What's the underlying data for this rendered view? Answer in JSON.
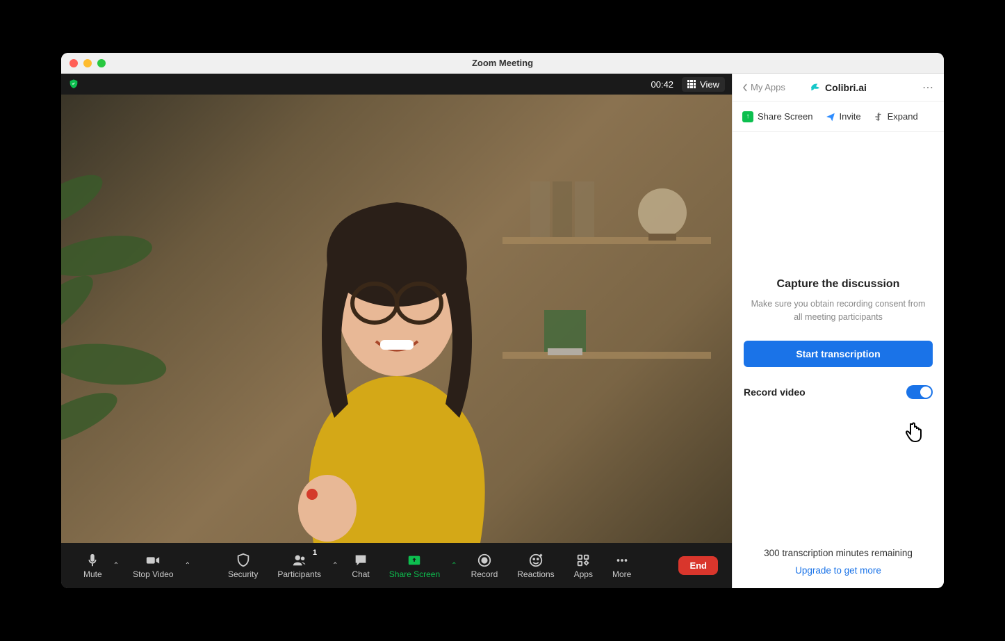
{
  "window": {
    "title": "Zoom Meeting"
  },
  "video_top": {
    "timer": "00:42",
    "view_label": "View"
  },
  "controls": {
    "mute": "Mute",
    "stop_video": "Stop Video",
    "security": "Security",
    "participants": "Participants",
    "participants_count": "1",
    "chat": "Chat",
    "share_screen": "Share Screen",
    "record": "Record",
    "reactions": "Reactions",
    "apps": "Apps",
    "more": "More",
    "end": "End"
  },
  "sidepanel": {
    "back_label": "My Apps",
    "app_name": "Colibri.ai",
    "actions": {
      "share": "Share Screen",
      "invite": "Invite",
      "expand": "Expand"
    },
    "capture": {
      "title": "Capture the discussion",
      "subtitle": "Make sure you obtain recording consent from all meeting participants",
      "button": "Start transcription"
    },
    "record_video_label": "Record video",
    "remaining_text": "300 transcription minutes remaining",
    "upgrade_text": "Upgrade to get more"
  }
}
